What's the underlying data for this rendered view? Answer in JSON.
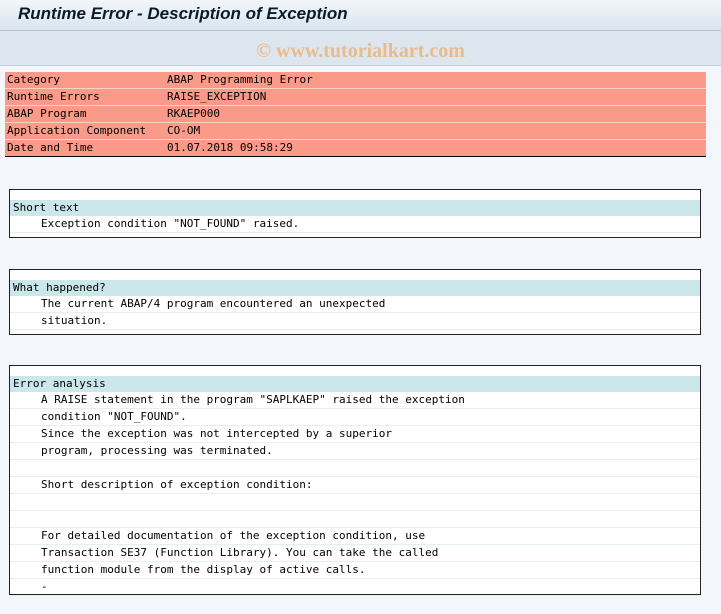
{
  "window": {
    "title": "Runtime Error - Description of Exception"
  },
  "watermark": "© www.tutorialkart.com",
  "details": [
    {
      "key": "Category",
      "value": "ABAP Programming Error"
    },
    {
      "key": "Runtime Errors",
      "value": "RAISE_EXCEPTION"
    },
    {
      "key": "ABAP Program",
      "value": "RKAEP000"
    },
    {
      "key": "Application Component",
      "value": "CO-OM"
    },
    {
      "key": "Date and Time",
      "value": "01.07.2018 09:58:29"
    }
  ],
  "short_text": {
    "header": "Short text",
    "lines": [
      "Exception condition \"NOT_FOUND\" raised."
    ]
  },
  "what_happened": {
    "header": "What happened?",
    "lines": [
      "The current ABAP/4 program encountered an unexpected",
      "situation."
    ]
  },
  "error_analysis": {
    "header": "Error analysis",
    "lines": [
      "A RAISE statement in the program \"SAPLKAEP\" raised the exception",
      "condition \"NOT_FOUND\".",
      "Since the exception was not intercepted by a superior",
      "program, processing was terminated.",
      "",
      "Short description of exception condition:",
      "",
      "",
      "For detailed documentation of the exception condition, use",
      "Transaction SE37 (Function Library). You can take the called",
      "function module from the display of active calls.",
      "-"
    ]
  }
}
